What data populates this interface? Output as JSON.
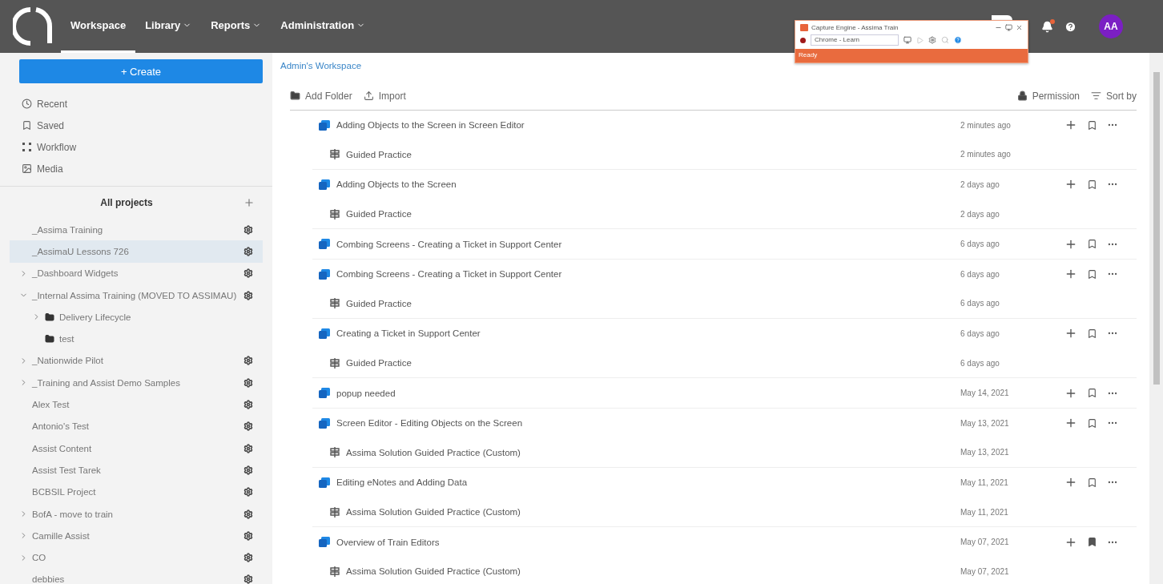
{
  "topbar": {
    "nav": [
      {
        "label": "Workspace",
        "selected": true,
        "has_menu": false
      },
      {
        "label": "Library",
        "selected": false,
        "has_menu": true
      },
      {
        "label": "Reports",
        "selected": false,
        "has_menu": true
      },
      {
        "label": "Administration",
        "selected": false,
        "has_menu": true
      }
    ],
    "notification_dot": true,
    "avatar": "AA"
  },
  "capture_window": {
    "title": "Capture Engine - Assima Train",
    "source": "Chrome - Learn",
    "status": "Ready"
  },
  "sidebar": {
    "create_button": "+ Create",
    "links": [
      {
        "label": "Recent",
        "kind": "recent"
      },
      {
        "label": "Saved",
        "kind": "saved"
      },
      {
        "label": "Workflow",
        "kind": "workflow"
      },
      {
        "label": "Media",
        "kind": "media"
      }
    ],
    "projects_title": "All projects",
    "projects": [
      {
        "label": "_Assima Training",
        "kind": "leaf",
        "selected": false
      },
      {
        "label": "_AssimaU Lessons 726",
        "kind": "leaf",
        "selected": true
      },
      {
        "label": "_Dashboard Widgets",
        "kind": "branch",
        "expanded": false,
        "selected": false
      },
      {
        "label": "_Internal Assima Training (MOVED TO ASSIMAU)",
        "kind": "branch",
        "expanded": true,
        "selected": false,
        "children": [
          {
            "label": "Delivery Lifecycle",
            "kind": "branch",
            "expanded": false
          },
          {
            "label": "test",
            "kind": "leaf"
          }
        ]
      },
      {
        "label": "_Nationwide Pilot",
        "kind": "branch",
        "expanded": false,
        "selected": false
      },
      {
        "label": "_Training and Assist Demo Samples",
        "kind": "branch",
        "expanded": false,
        "selected": false
      },
      {
        "label": "Alex Test",
        "kind": "leaf",
        "selected": false
      },
      {
        "label": "Antonio's Test",
        "kind": "leaf",
        "selected": false
      },
      {
        "label": "Assist Content",
        "kind": "leaf",
        "selected": false
      },
      {
        "label": "Assist Test Tarek",
        "kind": "leaf",
        "selected": false
      },
      {
        "label": "BCBSIL Project",
        "kind": "leaf",
        "selected": false
      },
      {
        "label": "BofA - move to train",
        "kind": "branch",
        "expanded": false,
        "selected": false
      },
      {
        "label": "Camille Assist",
        "kind": "branch",
        "expanded": false,
        "selected": false
      },
      {
        "label": "CO",
        "kind": "branch",
        "expanded": false,
        "selected": false
      },
      {
        "label": "debbies",
        "kind": "leaf",
        "selected": false
      }
    ]
  },
  "main": {
    "breadcrumb": "Admin's Workspace",
    "toolbar": {
      "add_folder": "Add Folder",
      "import": "Import",
      "permission": "Permission",
      "sort": "Sort by"
    },
    "groups": [
      [
        {
          "kind": "lesson",
          "title": "Adding Objects to the Screen in Screen Editor",
          "time": "2 minutes ago",
          "bookmarked": false
        },
        {
          "kind": "practice",
          "title": "Guided Practice",
          "time": "2 minutes ago"
        }
      ],
      [
        {
          "kind": "lesson",
          "title": "Adding Objects to the Screen",
          "time": "2 days ago",
          "bookmarked": false
        },
        {
          "kind": "practice",
          "title": "Guided Practice",
          "time": "2 days ago"
        }
      ],
      [
        {
          "kind": "lesson",
          "title": "Combing Screens - Creating a Ticket in Support Center",
          "time": "6 days ago",
          "bookmarked": false
        }
      ],
      [
        {
          "kind": "lesson",
          "title": "Combing Screens - Creating a Ticket in Support Center",
          "time": "6 days ago",
          "bookmarked": false
        },
        {
          "kind": "practice",
          "title": "Guided Practice",
          "time": "6 days ago"
        }
      ],
      [
        {
          "kind": "lesson",
          "title": "Creating a Ticket in Support Center",
          "time": "6 days ago",
          "bookmarked": false
        },
        {
          "kind": "practice",
          "title": "Guided Practice",
          "time": "6 days ago"
        }
      ],
      [
        {
          "kind": "lesson",
          "title": "popup needed",
          "time": "May 14, 2021",
          "bookmarked": false
        }
      ],
      [
        {
          "kind": "lesson",
          "title": "Screen Editor - Editing Objects on the Screen",
          "time": "May 13, 2021",
          "bookmarked": false
        },
        {
          "kind": "practice",
          "title": "Assima Solution Guided Practice (Custom)",
          "time": "May 13, 2021"
        }
      ],
      [
        {
          "kind": "lesson",
          "title": "Editing eNotes and Adding Data",
          "time": "May 11, 2021",
          "bookmarked": false
        },
        {
          "kind": "practice",
          "title": "Assima Solution Guided Practice (Custom)",
          "time": "May 11, 2021"
        }
      ],
      [
        {
          "kind": "lesson",
          "title": "Overview of Train Editors",
          "time": "May 07, 2021",
          "bookmarked": true
        },
        {
          "kind": "practice",
          "title": "Assima Solution Guided Practice (Custom)",
          "time": "May 07, 2021"
        }
      ]
    ]
  }
}
